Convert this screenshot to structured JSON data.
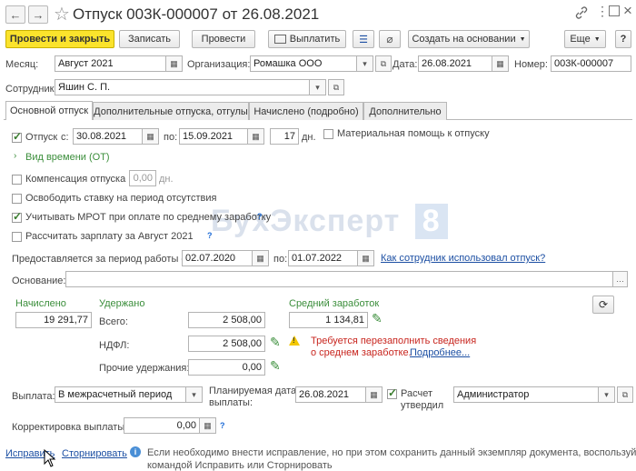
{
  "window": {
    "title": "Отпуск 003К-000007 от 26.08.2021",
    "nav_back": "←",
    "nav_forward": "→",
    "star": "☆",
    "link_icon": "link-icon",
    "more_icon": "more-icon",
    "maximize_icon": "maximize-icon",
    "close": "×"
  },
  "toolbar": {
    "post_close": "Провести и закрыть",
    "save": "Записать",
    "post": "Провести",
    "pay": "Выплатить",
    "create_based": "Создать на основании",
    "more": "Еще",
    "help": "?"
  },
  "header": {
    "month_label": "Месяц:",
    "month_value": "Август 2021",
    "org_label": "Организация:",
    "org_value": "Ромашка ООО",
    "date_label": "Дата:",
    "date_value": "26.08.2021",
    "number_label": "Номер:",
    "number_value": "003К-000007",
    "employee_label": "Сотрудник:",
    "employee_value": "Яшин С. П."
  },
  "tabs": [
    {
      "label": "Основной отпуск",
      "active": true
    },
    {
      "label": "Дополнительные отпуска, отгулы",
      "active": false
    },
    {
      "label": "Начислено (подробно)",
      "active": false
    },
    {
      "label": "Дополнительно",
      "active": false
    }
  ],
  "main": {
    "vacation_label": "Отпуск",
    "from_label": "с:",
    "from_value": "30.08.2021",
    "to_label": "по:",
    "to_value": "15.09.2021",
    "days_value": "17",
    "days_unit": "дн.",
    "material_aid": "Материальная помощь к отпуску",
    "time_type": "Вид времени (ОТ)",
    "compensation": "Компенсация отпуска",
    "compensation_value": "0,00",
    "compensation_unit": "дн.",
    "free_rate": "Освободить ставку на период отсутствия",
    "mrot": "Учитывать МРОТ при оплате по среднему заработку",
    "calc_salary": "Рассчитать зарплату за Август 2021",
    "work_period_label": "Предоставляется за период работы с:",
    "work_from": "02.07.2020",
    "work_to_label": "по:",
    "work_to": "01.07.2022",
    "how_used_link": "Как сотрудник использовал отпуск?",
    "basis_label": "Основание:",
    "basis_value": "",
    "accrued_header": "Начислено",
    "accrued_value": "19 291,77",
    "withheld_header": "Удержано",
    "total_label": "Всего:",
    "total_value": "2 508,00",
    "ndfl_label": "НДФЛ:",
    "ndfl_value": "2 508,00",
    "other_label": "Прочие удержания:",
    "other_value": "0,00",
    "avg_header": "Средний заработок",
    "avg_value": "1 134,81",
    "warning_line1": "Требуется перезаполнить сведения",
    "warning_line2": "о среднем заработке.",
    "warning_link": "Подробнее...",
    "payout_label": "Выплата:",
    "payout_value": "В межрасчетный период",
    "planned_label_1": "Планируемая дата",
    "planned_label_2": "выплаты:",
    "planned_value": "26.08.2021",
    "approved_label_1": "Расчет",
    "approved_label_2": "утвердил",
    "approved_value": "Администратор",
    "correction_label": "Корректировка выплаты:",
    "correction_value": "0,00"
  },
  "footer": {
    "fix_link": "Исправить",
    "storno_link": "Сторнировать",
    "info_line1": "Если необходимо внести исправление, но при этом сохранить данный экземпляр документа, воспользуйтесь",
    "info_line2": "командой Исправить или Сторнировать"
  },
  "watermark": {
    "text": "БухЭксперт",
    "digit": "8"
  },
  "colors": {
    "primary_button": "#fbe32c",
    "green_text": "#3b8e3b",
    "link": "#1c4fa3",
    "warning_red": "#c8261f"
  }
}
